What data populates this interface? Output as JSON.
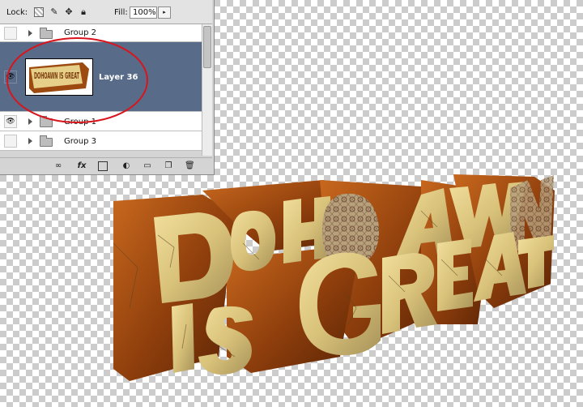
{
  "layers_panel": {
    "lock_label": "Lock:",
    "fill_label": "Fill:",
    "fill_value": "100%",
    "fill_arrow": "▸",
    "layers": [
      {
        "name": "Group 2",
        "type": "group",
        "visible": false,
        "selected": false
      },
      {
        "name": "Layer 36",
        "type": "layer",
        "visible": true,
        "selected": true
      },
      {
        "name": "Group 1",
        "type": "group",
        "visible": true,
        "selected": false
      },
      {
        "name": "Group 3",
        "type": "group",
        "visible": false,
        "selected": false
      }
    ],
    "eye_glyph": "👁",
    "bottom_icons": [
      "link-icon",
      "fx-icon",
      "layer-mask-icon",
      "adjustment-icon",
      "new-group-icon",
      "new-layer-icon",
      "trash-icon"
    ],
    "fx_label": "fx",
    "thumbnail_text": "DOHOAWN IS GREAT"
  },
  "artwork": {
    "text_line1": "DOHOAWN",
    "text_line2": "IS GREAT"
  },
  "colors": {
    "selected_row": "#586c8a",
    "annotation": "#d8141c",
    "letter_face": "#e6cf88",
    "letter_side": "#9c4a10"
  }
}
